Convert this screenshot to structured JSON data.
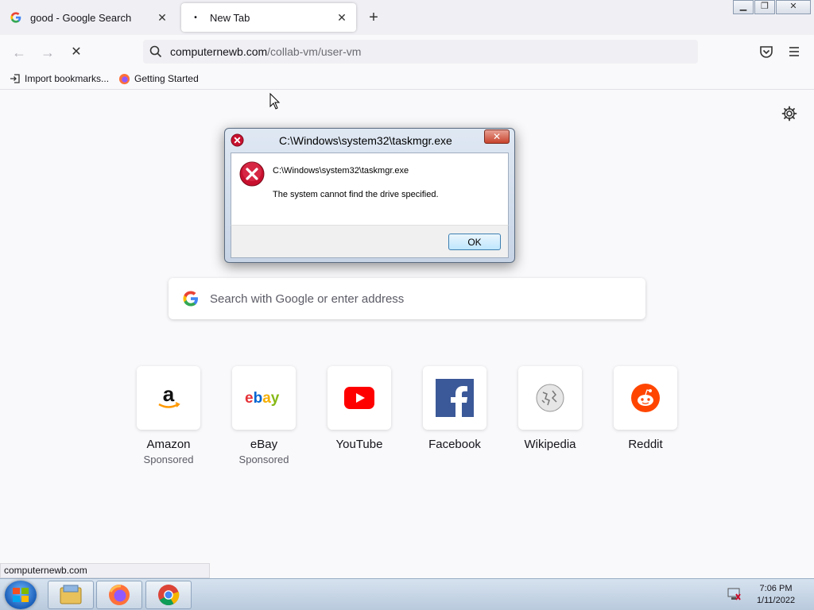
{
  "browser": {
    "tabs": [
      {
        "label": "good - Google Search",
        "favicon": "google-g-icon",
        "active": false
      },
      {
        "label": "New Tab",
        "favicon": "loading-dot-icon",
        "active": true
      }
    ],
    "nav": {
      "url_host": "computernewb.com",
      "url_path": "/collab-vm/user-vm"
    },
    "bookmarks": [
      {
        "label": "Import bookmarks...",
        "icon": "import-icon"
      },
      {
        "label": "Getting Started",
        "icon": "firefox-icon"
      }
    ]
  },
  "newtab": {
    "search_placeholder": "Search with Google or enter address",
    "top_sites": [
      {
        "name": "Amazon",
        "sub": "Sponsored",
        "icon": "amazon-icon"
      },
      {
        "name": "eBay",
        "sub": "Sponsored",
        "icon": "ebay-icon"
      },
      {
        "name": "YouTube",
        "sub": "",
        "icon": "youtube-icon"
      },
      {
        "name": "Facebook",
        "sub": "",
        "icon": "facebook-icon"
      },
      {
        "name": "Wikipedia",
        "sub": "",
        "icon": "wikipedia-icon"
      },
      {
        "name": "Reddit",
        "sub": "",
        "icon": "reddit-icon"
      }
    ]
  },
  "dialog": {
    "title": "C:\\Windows\\system32\\taskmgr.exe",
    "line1": "C:\\Windows\\system32\\taskmgr.exe",
    "line2": "The system cannot find the drive specified.",
    "ok_label": "OK"
  },
  "status": {
    "link": "computernewb.com"
  },
  "taskbar": {
    "time": "7:06 PM",
    "date": "1/11/2022"
  },
  "colors": {
    "accent": "#0061e0",
    "error_red": "#c8102e",
    "youtube_red": "#ff0000",
    "facebook_blue": "#1877f2",
    "reddit_orange": "#ff4500"
  }
}
